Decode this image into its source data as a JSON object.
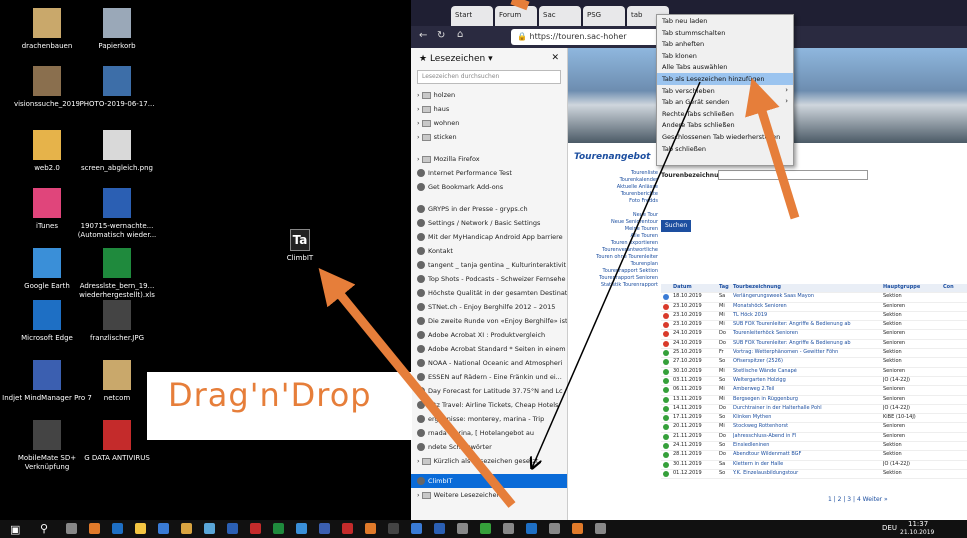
{
  "desktop": {
    "icons": [
      {
        "label": "drachenbauen"
      },
      {
        "label": "Papierkorb"
      },
      {
        "label": "visionssuche_2019"
      },
      {
        "label": "PHOTO-2019-06-17..."
      },
      {
        "label": "web2.0"
      },
      {
        "label": "screen_abgleich.png"
      },
      {
        "label": "iTunes"
      },
      {
        "label": "190715-wernachte... (Automatisch wieder..."
      },
      {
        "label": "Google Earth"
      },
      {
        "label": "Adresslste_bern_19... wiederhergestellt).xls"
      },
      {
        "label": "Microsoft Edge"
      },
      {
        "label": "franzlischer.JPG"
      },
      {
        "label": "Indjet MindManager Pro 7"
      },
      {
        "label": "netcom"
      },
      {
        "label": "MobileMate SD+ Verknüpfung"
      },
      {
        "label": "G DATA ANTIVIRUS"
      }
    ],
    "dragged_icon": {
      "label": "ClimbIT",
      "glyph": "Ta"
    }
  },
  "annotation": {
    "text": "Drag'n'Drop"
  },
  "browser": {
    "tabs": [
      "Start",
      "Forum",
      "Sac",
      "PSG",
      "tab"
    ],
    "url": "https://touren.sac-hoher",
    "sidebar": {
      "title": "Lesezeichen",
      "search_placeholder": "Lesezeichen durchsuchen",
      "folders": [
        "holzen",
        "haus",
        "wohnen",
        "sticken",
        "Mozilla Firefox"
      ],
      "items": [
        "Internet Performance Test",
        "Get Bookmark Add-ons",
        "GRYPS in der Presse - gryps.ch",
        "Settings / Network / Basic Settings",
        "Mit der MyHandicap Android App barriere",
        "Kontakt",
        "tangent _ tanja gentina _ Kulturinteraktivit",
        "Top Shots - Podcasts - Schweizer Fernsehe",
        "Höchste Qualität in der gesamten Destinat",
        "STNet.ch - Enjoy Berghilfe 2012 – 2015",
        "Die zweite Runde von «Enjoy Berghilfe» ist",
        "Adobe Acrobat XI : Produktvergleich",
        "Adobe Acrobat Standard * Seiten in einem",
        "NOAA - National Oceanic and Atmospheri",
        "ESSEN auf Rädern - Eine Fränkin und ei...",
        "Day Forecast for Latitude 37.75°N and Lc",
        "bitz Travel: Airline Tickets, Cheap Hotels",
        "ergebnisse: monterey, marina - Trip",
        "rnada Marina, [ Hotelangebot au",
        "ndete Schlagwörter"
      ],
      "recent": "Kürzlich als Lesezeichen gesetzt",
      "selected": "ClimbIT",
      "other": "Weitere Lesezeichen"
    },
    "page": {
      "logo": "Tourenangebot",
      "search_label": "Tourenbezeichnung",
      "search_button": "Suchen",
      "nav": [
        "Tourenliste",
        "Tourenkalender",
        "Aktuelle Anlässe",
        "Tourenberichte",
        "Foto Fredds",
        "",
        "Neue Tour",
        "Neue Seniorentour",
        "Meine Touren",
        "Alle Touren",
        "Touren exportieren",
        "Tourenverantwortliche",
        "Touren ohne Tourenleiter",
        "Tourenplan",
        "Tourenrapport Sektion",
        "Tourenrapport Senioren",
        "Statistik Tourenrapport"
      ],
      "headers": [
        "Datum",
        "Tag",
        "Tourbezeichnung",
        "Hauptgruppe",
        "Con"
      ],
      "rows": [
        {
          "date": "18.10.2019",
          "day": "Sa",
          "name": "Verlängerungsweek Saas Mayon",
          "group": "Sektion",
          "status": "blue"
        },
        {
          "date": "23.10.2019",
          "day": "Mi",
          "name": "Monatshöck Senioren",
          "group": "Senioren",
          "status": "red"
        },
        {
          "date": "23.10.2019",
          "day": "Mi",
          "name": "TL Höck 2019",
          "group": "Sektion",
          "status": "red"
        },
        {
          "date": "23.10.2019",
          "day": "Mi",
          "name": "SUB FOX Tourenleiter: Angriffe & Bedienung ab",
          "group": "Sektion",
          "status": "red"
        },
        {
          "date": "24.10.2019",
          "day": "Do",
          "name": "Tourenleiterhöck Senioren",
          "group": "Senioren",
          "status": "red"
        },
        {
          "date": "24.10.2019",
          "day": "Do",
          "name": "SUB FOX Tourenleiter: Angriffe & Bedienung ab",
          "group": "Senioren",
          "status": "red"
        },
        {
          "date": "25.10.2019",
          "day": "Fr",
          "name": "Vortrag: Wetterphänomen - Gewitter Föhn",
          "group": "Sektion",
          "status": "green"
        },
        {
          "date": "27.10.2019",
          "day": "So",
          "name": "Ofiserspitzer (2526)",
          "group": "Sektion",
          "status": "green"
        },
        {
          "date": "30.10.2019",
          "day": "Mi",
          "name": "Stetlische Wände Canapé",
          "group": "Senioren",
          "status": "green"
        },
        {
          "date": "03.11.2019",
          "day": "So",
          "name": "Weltergarten Holzigg",
          "group": "JO (14-22J)",
          "status": "green"
        },
        {
          "date": "06.11.2019",
          "day": "Mi",
          "name": "Amberweg 2.Teil",
          "group": "Senioren",
          "status": "green"
        },
        {
          "date": "13.11.2019",
          "day": "Mi",
          "name": "Bergsegen in Rüggenburg",
          "group": "Senioren",
          "status": "green"
        },
        {
          "date": "14.11.2019",
          "day": "Do",
          "name": "Durchtrainer in der Halterhalle Pohl",
          "group": "JO (14-22J)",
          "status": "green"
        },
        {
          "date": "17.11.2019",
          "day": "So",
          "name": "Klinken Mythen",
          "group": "KiBE (10-14J)",
          "status": "green"
        },
        {
          "date": "20.11.2019",
          "day": "Mi",
          "name": "Stockweg Rottenhorst",
          "group": "Senioren",
          "status": "green"
        },
        {
          "date": "21.11.2019",
          "day": "Do",
          "name": "Jahresschluss-Abend in Fl",
          "group": "Senioren",
          "status": "green"
        },
        {
          "date": "24.11.2019",
          "day": "So",
          "name": "Einsiedleninen",
          "group": "Sektion",
          "status": "green"
        },
        {
          "date": "28.11.2019",
          "day": "Do",
          "name": "Abendtour Wildenmatt BGF",
          "group": "Sektion",
          "status": "green"
        },
        {
          "date": "30.11.2019",
          "day": "Sa",
          "name": "Klettern in der Halle",
          "group": "JO (14-22J)",
          "status": "green"
        },
        {
          "date": "01.12.2019",
          "day": "So",
          "name": "Y.K. Einzelausbildungstour",
          "group": "Sektion",
          "status": "green"
        }
      ],
      "pager": "1 | 2 | 3 | 4  Weiter »"
    },
    "context_menu": [
      {
        "label": "Tab neu laden",
        "sub": false
      },
      {
        "label": "Tab stummschalten",
        "sub": false
      },
      {
        "label": "Tab anheften",
        "sub": false
      },
      {
        "label": "Tab klonen",
        "sub": false
      },
      {
        "label": "Alle Tabs auswählen",
        "sub": false
      },
      {
        "label": "Tab als Lesezeichen hinzufügen",
        "sub": false,
        "highlight": true
      },
      {
        "label": "Tab verschieben",
        "sub": true
      },
      {
        "label": "Tab an Gerät senden",
        "sub": true
      },
      {
        "label": "Rechte Tabs schließen",
        "sub": false
      },
      {
        "label": "Andere Tabs schließen",
        "sub": false
      },
      {
        "label": "Geschlossenen Tab wiederherstellen",
        "sub": false
      },
      {
        "label": "Tab schließen",
        "sub": false
      }
    ]
  },
  "taskbar": {
    "lang": "DEU",
    "time": "11:37",
    "date": "21.10.2019"
  },
  "colors": {
    "arrow": "#e67e3a",
    "selection": "#0a6bd8"
  }
}
